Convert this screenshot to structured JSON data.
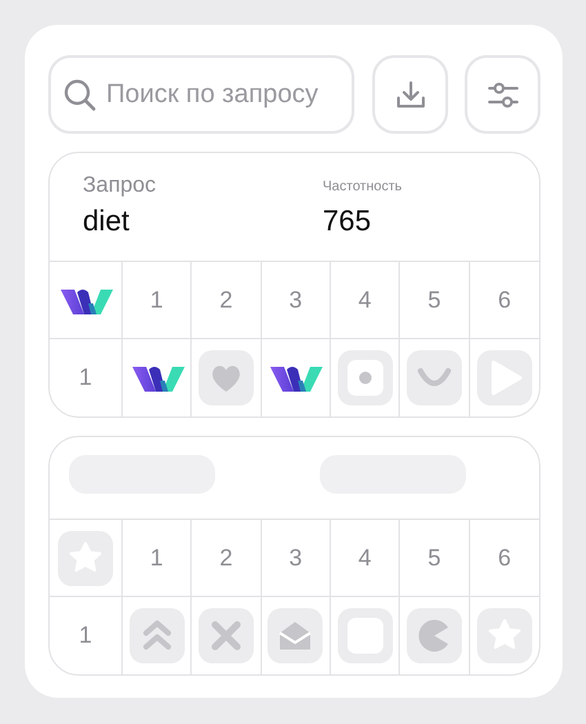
{
  "search": {
    "placeholder": "Поиск по запросу"
  },
  "toolbar": [
    {
      "kind": "download"
    },
    {
      "kind": "filter"
    }
  ],
  "cards": [
    {
      "header": {
        "kind": "info",
        "fields": [
          {
            "label": "Запрос",
            "value": "diet"
          },
          {
            "label": "Частотность",
            "value": "765"
          }
        ]
      },
      "corner": {
        "kind": "logo"
      },
      "columns": [
        "1",
        "2",
        "3",
        "4",
        "5",
        "6"
      ],
      "rows": [
        {
          "label": "1",
          "cells": [
            {
              "kind": "logo"
            },
            {
              "kind": "heart"
            },
            {
              "kind": "logo"
            },
            {
              "kind": "dot"
            },
            {
              "kind": "smile"
            },
            {
              "kind": "play"
            }
          ]
        }
      ]
    },
    {
      "header": {
        "kind": "skeleton"
      },
      "corner": {
        "kind": "star"
      },
      "columns": [
        "1",
        "2",
        "3",
        "4",
        "5",
        "6"
      ],
      "rows": [
        {
          "label": "1",
          "cells": [
            {
              "kind": "chevrons"
            },
            {
              "kind": "cross"
            },
            {
              "kind": "mail"
            },
            {
              "kind": "square"
            },
            {
              "kind": "pacman"
            },
            {
              "kind": "star"
            }
          ]
        }
      ]
    }
  ]
}
